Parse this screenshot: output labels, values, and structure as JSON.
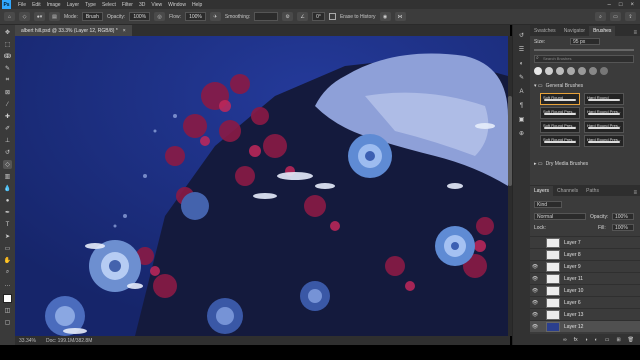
{
  "menubar": {
    "logo": "Ps",
    "items": [
      "File",
      "Edit",
      "Image",
      "Layer",
      "Type",
      "Select",
      "Filter",
      "3D",
      "View",
      "Window",
      "Help"
    ]
  },
  "options": {
    "mode_label": "Mode:",
    "mode_value": "Brush",
    "opacity_label": "Opacity:",
    "opacity_value": "100%",
    "flow_label": "Flow:",
    "flow_value": "100%",
    "smoothing_label": "Smoothing:",
    "angle_value": "0°",
    "erase_history_label": "Erase to History"
  },
  "document": {
    "tab_title": "albert hill.psd @ 33.3% (Layer 12, RGB/8) *",
    "close_glyph": "×"
  },
  "status": {
    "zoom": "33.34%",
    "doc": "Doc: 199.1M/382.8M"
  },
  "brushes_panel": {
    "tabs": [
      "Swatches",
      "Navigator",
      "Brushes"
    ],
    "active_tab": "Brushes",
    "size_label": "Size:",
    "size_value": "95 px",
    "search_placeholder": "Search Brushes",
    "folder_general": "General Brushes",
    "folder_dry": "Dry Media Brushes",
    "brushes": [
      "Soft Round",
      "Hard Round",
      "Soft Round Pres...",
      "Hard Round Pres...",
      "Soft Round Pres...",
      "Hard Round Pres...",
      "Soft Round Pres...",
      "Hard Round Pres..."
    ]
  },
  "layers_panel": {
    "tabs": [
      "Layers",
      "Channels",
      "Paths"
    ],
    "active_tab": "Layers",
    "kind_label": "Kind",
    "blend_mode": "Normal",
    "opacity_label": "Opacity:",
    "opacity_value": "100%",
    "lock_label": "Lock:",
    "fill_label": "Fill:",
    "fill_value": "100%",
    "layers": [
      "Layer 7",
      "Layer 8",
      "Layer 9",
      "Layer 11",
      "Layer 10",
      "Layer 6",
      "Layer 13",
      "Layer 12"
    ],
    "active_layer": "Layer 12"
  },
  "icons": {
    "close": "close-icon",
    "eye": "eye-icon",
    "folder": "folder-icon",
    "search": "search-icon"
  }
}
